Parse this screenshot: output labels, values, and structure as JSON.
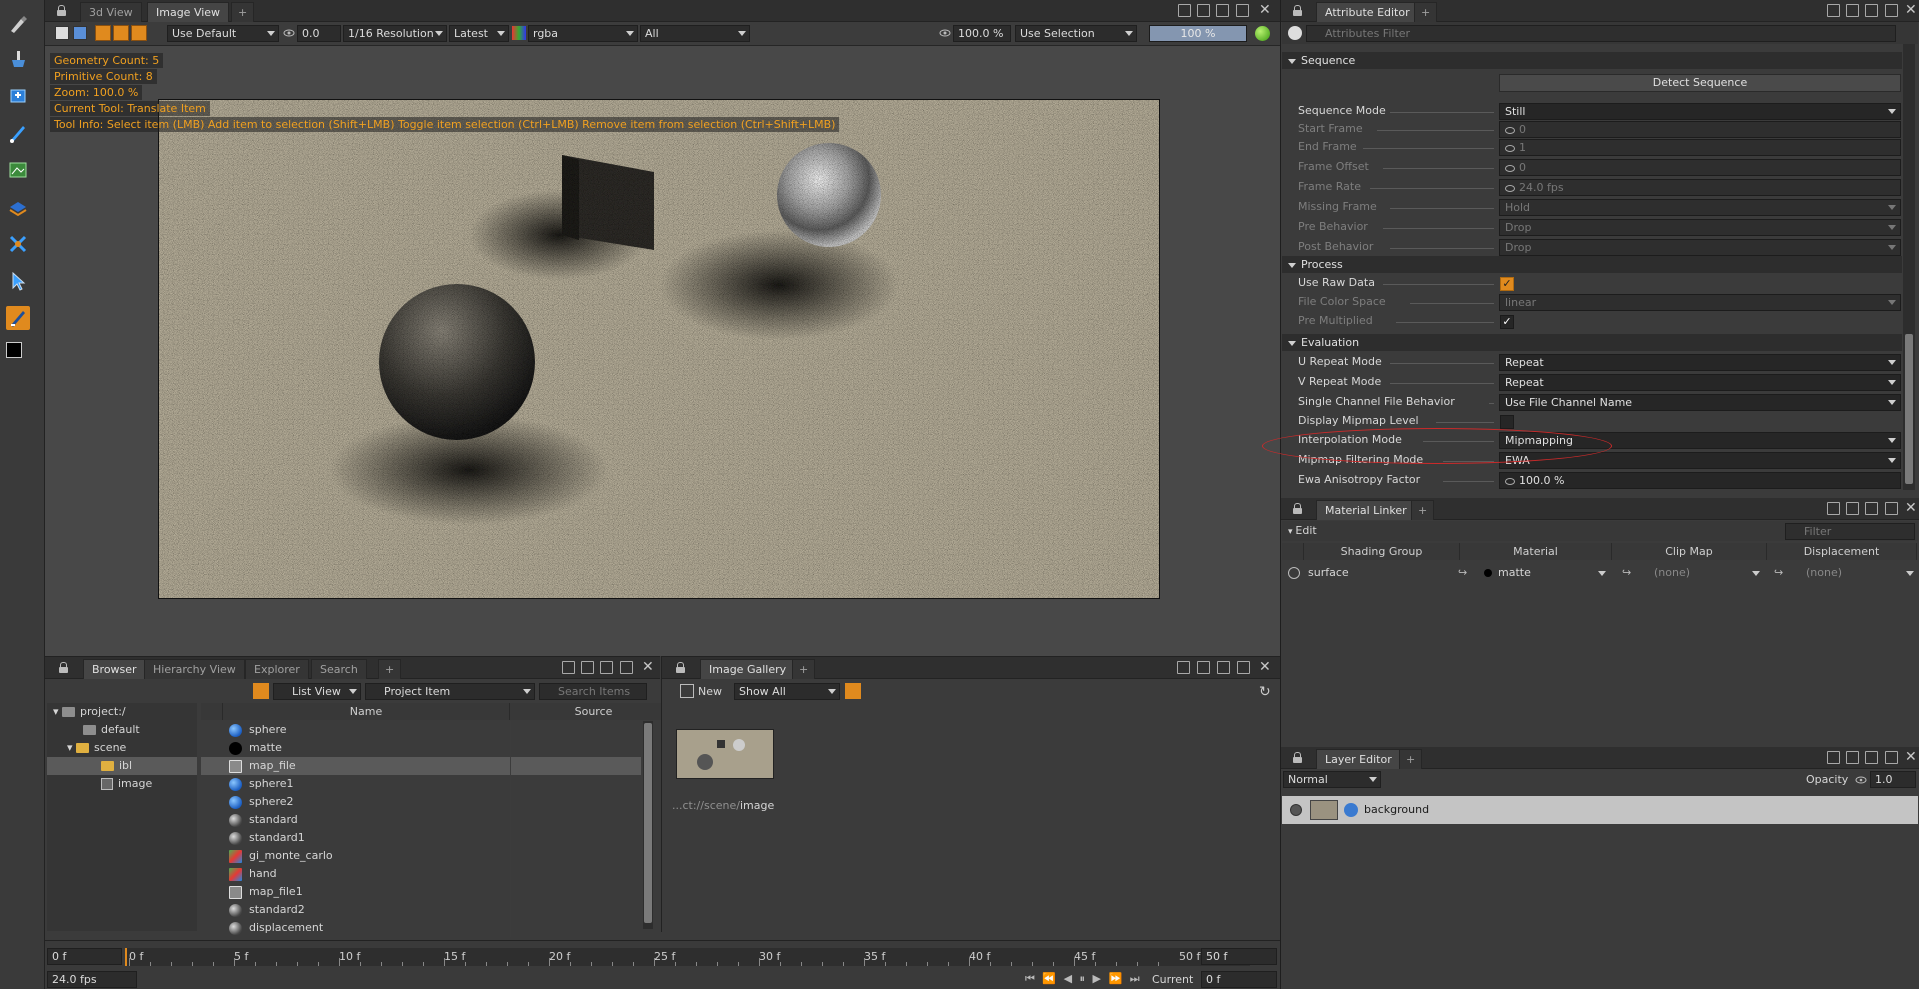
{
  "viewer": {
    "tabs": [
      "3d View",
      "Image View"
    ],
    "active_tab": "Image View",
    "toolbar": {
      "layer_combo": "Use Default",
      "exposure": "0.0",
      "resolution": "1/16 Resolution",
      "version": "Latest",
      "channels": "rgba",
      "filter": "All",
      "zoom": "100.0 %",
      "selection_mode": "Use Selection",
      "progress": "100 %",
      "progress_fraction": 1.0
    },
    "overlay": {
      "geometry_count": "Geometry Count: 5",
      "primitive_count": "Primitive Count: 8",
      "zoom": "Zoom: 100.0 %",
      "current_tool": "Current Tool: Translate Item",
      "tool_info": "Tool Info: Select item (LMB)  Add item to selection (Shift+LMB)  Toggle item selection (Ctrl+LMB)  Remove item from selection (Ctrl+Shift+LMB)"
    }
  },
  "browser": {
    "tabs": [
      "Browser",
      "Hierarchy View",
      "Explorer",
      "Search"
    ],
    "active_tab": "Browser",
    "view_mode": "List View",
    "filter": "Project Item",
    "search_placeholder": "Search Items",
    "columns": [
      "Name",
      "Source"
    ],
    "tree": [
      {
        "label": "project:/",
        "depth": 0
      },
      {
        "label": "default",
        "depth": 1
      },
      {
        "label": "scene",
        "depth": 1
      },
      {
        "label": "ibl",
        "depth": 2
      },
      {
        "label": "image",
        "depth": 2
      }
    ],
    "items": [
      {
        "name": "sphere",
        "icon": "blue"
      },
      {
        "name": "matte",
        "icon": "black"
      },
      {
        "name": "map_file",
        "icon": "sq"
      },
      {
        "name": "sphere1",
        "icon": "blue"
      },
      {
        "name": "sphere2",
        "icon": "blue"
      },
      {
        "name": "standard",
        "icon": "gray"
      },
      {
        "name": "standard1",
        "icon": "gray"
      },
      {
        "name": "gi_monte_carlo",
        "icon": "tex"
      },
      {
        "name": "hand",
        "icon": "tex"
      },
      {
        "name": "map_file1",
        "icon": "sq"
      },
      {
        "name": "standard2",
        "icon": "gray"
      },
      {
        "name": "displacement",
        "icon": "gray"
      }
    ]
  },
  "gallery": {
    "tab": "Image Gallery",
    "new_label": "New",
    "filter": "Show All",
    "item_prefix": "...ct://scene/",
    "item_name": "image"
  },
  "attribute_editor": {
    "tab": "Attribute Editor",
    "filter_placeholder": "Attributes Filter",
    "sections": {
      "sequence": "Sequence",
      "process": "Process",
      "evaluation": "Evaluation"
    },
    "detect_sequence": "Detect Sequence",
    "rows": {
      "sequence_mode": {
        "label": "Sequence Mode",
        "value": "Still"
      },
      "start_frame": {
        "label": "Start Frame",
        "value": "0"
      },
      "end_frame": {
        "label": "End Frame",
        "value": "1"
      },
      "frame_offset": {
        "label": "Frame Offset",
        "value": "0"
      },
      "frame_rate": {
        "label": "Frame Rate",
        "value": "24.0 fps"
      },
      "missing_frame": {
        "label": "Missing Frame",
        "value": "Hold"
      },
      "pre_behavior": {
        "label": "Pre Behavior",
        "value": "Drop"
      },
      "post_behavior": {
        "label": "Post Behavior",
        "value": "Drop"
      },
      "use_raw_data": {
        "label": "Use Raw Data",
        "checked": true
      },
      "file_color_space": {
        "label": "File Color Space",
        "value": "linear"
      },
      "pre_multiplied": {
        "label": "Pre Multiplied",
        "checked": true
      },
      "u_repeat": {
        "label": "U Repeat Mode",
        "value": "Repeat"
      },
      "v_repeat": {
        "label": "V Repeat Mode",
        "value": "Repeat"
      },
      "single_channel": {
        "label": "Single Channel File Behavior",
        "value": "Use File Channel Name"
      },
      "display_mipmap": {
        "label": "Display Mipmap Level",
        "checked": false
      },
      "interp_mode": {
        "label": "Interpolation Mode",
        "value": "Mipmapping"
      },
      "mipmap_filter": {
        "label": "Mipmap Filtering Mode",
        "value": "EWA"
      },
      "ewa_factor": {
        "label": "Ewa Anisotropy Factor",
        "value": "100.0 %"
      }
    }
  },
  "material_linker": {
    "tab": "Material Linker",
    "edit_label": "Edit",
    "filter_placeholder": "Filter",
    "columns": [
      "Shading Group",
      "Material",
      "Clip Map",
      "Displacement"
    ],
    "row": {
      "group": "surface",
      "material": "matte",
      "clip": "(none)",
      "disp": "(none)"
    }
  },
  "layer_editor": {
    "tab": "Layer Editor",
    "blend_mode": "Normal",
    "opacity_label": "Opacity",
    "opacity_value": "1.0",
    "layer_name": "background"
  },
  "timeline": {
    "start": "0 f",
    "end": "50 f",
    "ticks": [
      "0 f",
      "5 f",
      "10 f",
      "15 f",
      "20 f",
      "25 f",
      "30 f",
      "35 f",
      "40 f",
      "45 f",
      "50 f"
    ],
    "fps": "24.0 fps",
    "current_label": "Current",
    "current_value": "0 f"
  },
  "colors": {
    "accent": "#e08a1e",
    "highlight": "#cc2a2a"
  }
}
